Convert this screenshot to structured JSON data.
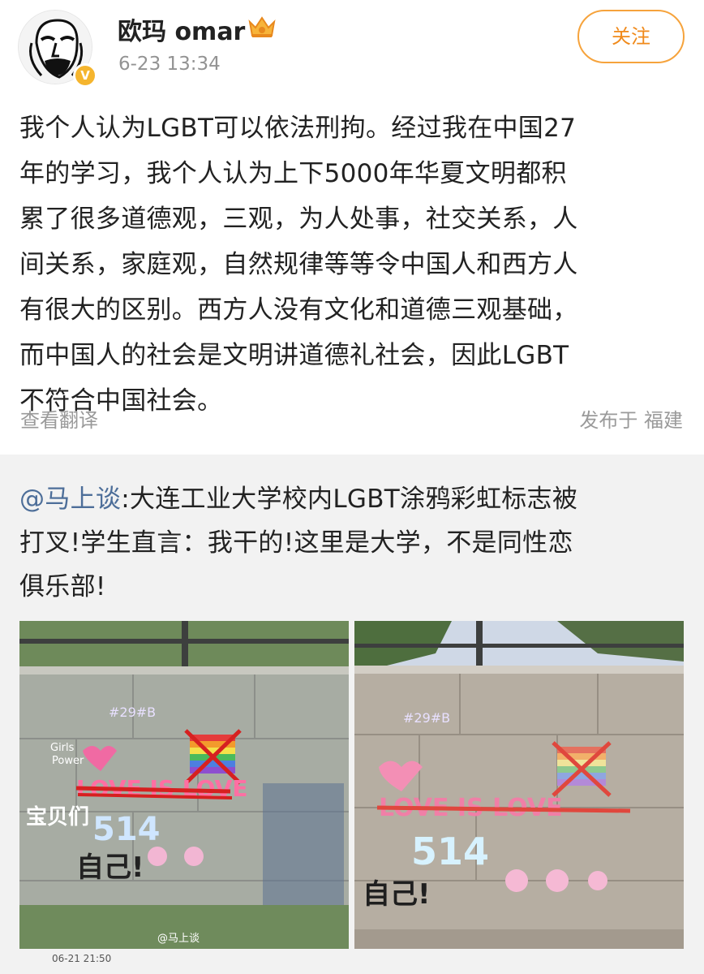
{
  "post": {
    "author": "欧玛 omar",
    "time": "6-23 13:34",
    "follow_label": "关注",
    "verified_mark": "V",
    "text_lines": [
      "我个人认为LGBT可以依法刑拘。经过我在中国27",
      "年的学习，我个人认为上下5000年华夏文明都积",
      "累了很多道德观，三观，为人处事，社交关系，人",
      "间关系，家庭观，自然规律等等令中国人和西方人",
      "有很大的区别。西方人没有文化和道德三观基础，",
      "而中国人的社会是文明讲道德礼社会，因此LGBT",
      "不符合中国社会。"
    ],
    "translate_label": "查看翻译",
    "location": "发布于 福建"
  },
  "repost": {
    "mention": "@马上谈",
    "text_first_rest": ":大连工业大学校内LGBT涂鸦彩虹标志被",
    "text_lines": [
      "打叉!学生直言：我干的!这里是大学，不是同性恋",
      "俱乐部!"
    ],
    "watermark": "@马上谈",
    "photo_caption": "06-21 21:50",
    "graffiti": {
      "love": "LOVE IS LOVE",
      "number": "514",
      "zi_ji": "自己!",
      "bao_bei": "宝贝们",
      "tag": "#29#B",
      "girls": "Girls",
      "power": "Power"
    }
  },
  "colors": {
    "accent": "#f08a1b",
    "link": "#4d6e99",
    "muted": "#9a9a9a",
    "repost_bg": "#f2f2f2"
  },
  "icons": [
    "crown-icon",
    "verified-icon",
    "avatar"
  ]
}
